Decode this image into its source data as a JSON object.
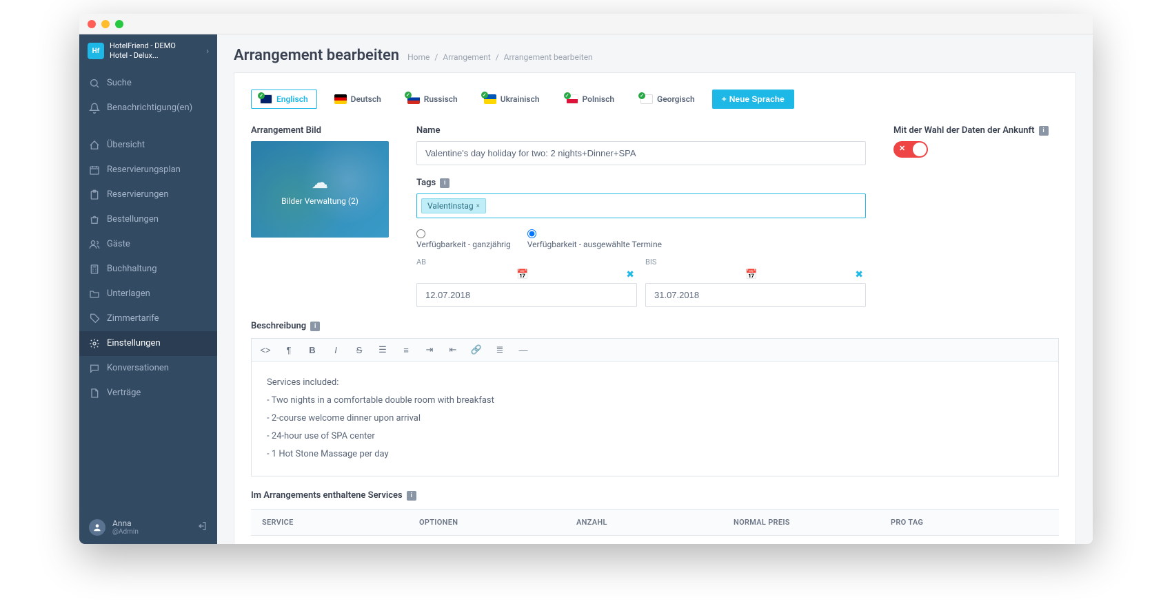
{
  "hotel": {
    "line1": "HotelFriend - DEMO",
    "line2": "Hotel - Delux..."
  },
  "sidebar": {
    "search": "Suche",
    "notifications": "Benachrichtigung(en)",
    "items": [
      {
        "label": "Übersicht",
        "icon": "home"
      },
      {
        "label": "Reservierungsplan",
        "icon": "calendar"
      },
      {
        "label": "Reservierungen",
        "icon": "clipboard"
      },
      {
        "label": "Bestellungen",
        "icon": "bag"
      },
      {
        "label": "Gäste",
        "icon": "users"
      },
      {
        "label": "Buchhaltung",
        "icon": "calc"
      },
      {
        "label": "Unterlagen",
        "icon": "folder"
      },
      {
        "label": "Zimmertarife",
        "icon": "tag"
      },
      {
        "label": "Einstellungen",
        "icon": "gear",
        "active": true
      },
      {
        "label": "Konversationen",
        "icon": "chat"
      },
      {
        "label": "Verträge",
        "icon": "file"
      }
    ],
    "user": {
      "name": "Anna",
      "handle": "@Admin"
    }
  },
  "page": {
    "title": "Arrangement bearbeiten",
    "crumb_home": "Home",
    "crumb_arr": "Arrangement",
    "crumb_edit": "Arrangement bearbeiten"
  },
  "langs": {
    "en": "Englisch",
    "de": "Deutsch",
    "ru": "Russisch",
    "uk": "Ukrainisch",
    "pl": "Polnisch",
    "ge": "Georgisch",
    "add": "Neue Sprache"
  },
  "form": {
    "image_label": "Arrangement Bild",
    "image_btn": "Bilder Verwaltung (2)",
    "name_label": "Name",
    "name_value": "Valentine's day holiday for two: 2 nights+Dinner+SPA",
    "arrival_label": "Mit der Wahl der Daten der Ankunft",
    "tags_label": "Tags",
    "tag0": "Valentinstag",
    "avail_year": "Verfügbarkeit - ganzjährig",
    "avail_sel": "Verfügbarkeit - ausgewählte Termine",
    "ab": "AB",
    "bis": "BIS",
    "date_from": "12.07.2018",
    "date_to": "31.07.2018",
    "desc_label": "Beschreibung",
    "desc_intro": "Services included:",
    "desc_l1": "- Two nights in a comfortable double room with breakfast",
    "desc_l2": "- 2-course welcome dinner upon arrival",
    "desc_l3": "- 24-hour use of SPA center",
    "desc_l4": "- 1 Hot Stone Massage per day",
    "services_label": "Im Arrangements enthaltene Services",
    "th_service": "SERVICE",
    "th_opt": "OPTIONEN",
    "th_qty": "ANZAHL",
    "th_price": "NORMAL PREIS",
    "th_day": "PRO TAG"
  }
}
